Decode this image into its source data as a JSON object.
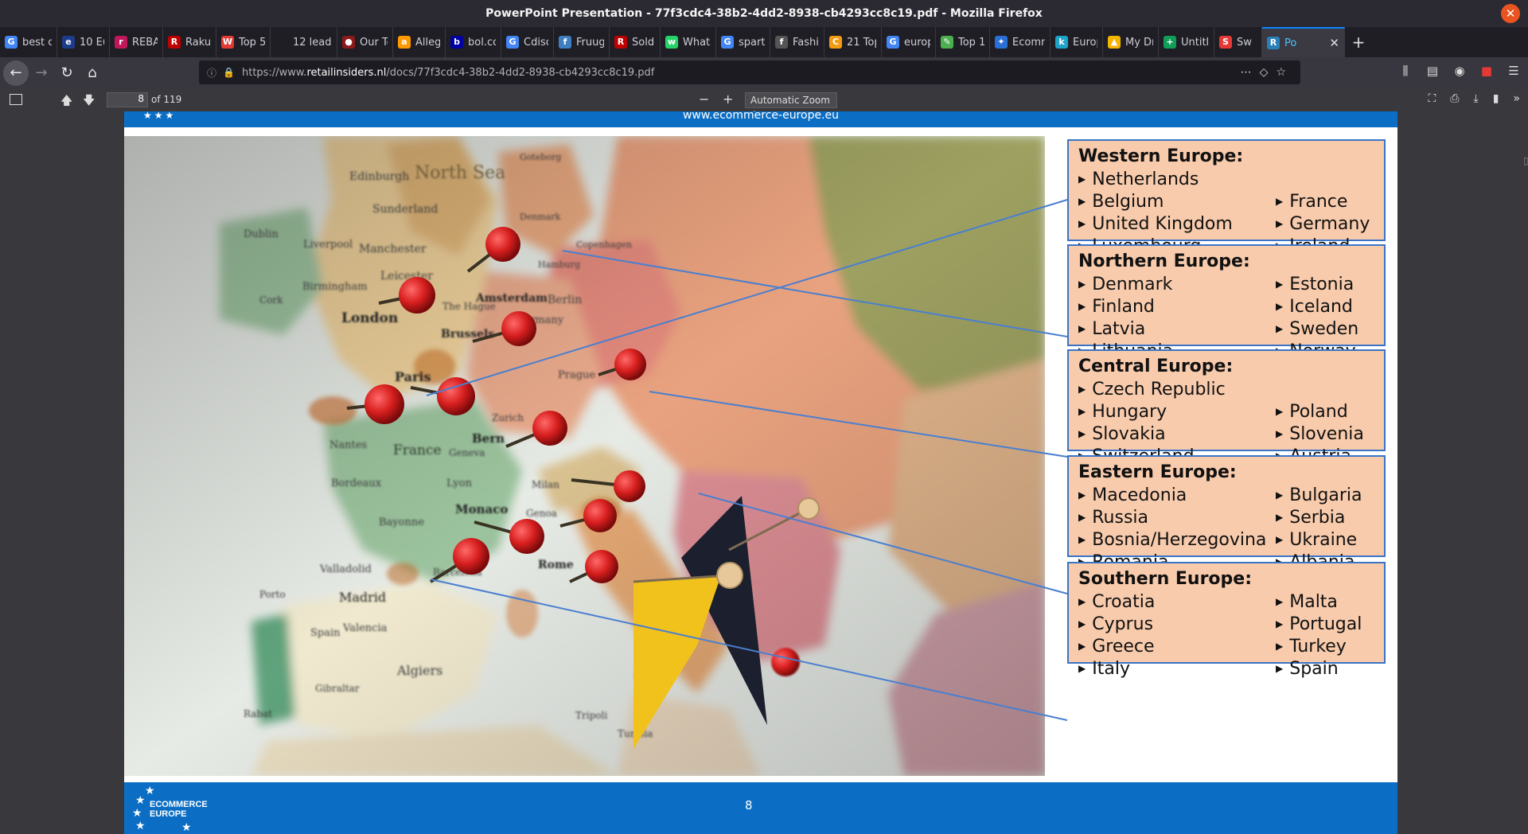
{
  "window": {
    "title": "PowerPoint Presentation - 77f3cdc4-38b2-4dd2-8938-cb4293cc8c19.pdf - Mozilla Firefox"
  },
  "tabs": [
    {
      "label": "best c",
      "icon": "google-icon",
      "color": "#4285f4",
      "glyph": "G"
    },
    {
      "label": "10 Eur",
      "icon": "e-icon",
      "color": "#1e3c8c",
      "glyph": "e"
    },
    {
      "label": "REBAI",
      "icon": "rebate-icon",
      "color": "#c2185b",
      "glyph": "r"
    },
    {
      "label": "Rakut",
      "icon": "rakuten-icon",
      "color": "#bf0000",
      "glyph": "R"
    },
    {
      "label": "Top 5",
      "icon": "w-icon",
      "color": "#e53935",
      "glyph": "W"
    },
    {
      "label": "12 leading",
      "icon": "blank-icon",
      "color": "#1f1e25",
      "glyph": ""
    },
    {
      "label": "Our Te",
      "icon": "circle-icon",
      "color": "#8b1a1a",
      "glyph": "●"
    },
    {
      "label": "Allegr",
      "icon": "amazon-icon",
      "color": "#ff9900",
      "glyph": "a"
    },
    {
      "label": "bol.co",
      "icon": "bol-icon",
      "color": "#0000a4",
      "glyph": "b"
    },
    {
      "label": "Cdisco",
      "icon": "google-icon",
      "color": "#4285f4",
      "glyph": "G"
    },
    {
      "label": "Fruug",
      "icon": "fruugo-icon",
      "color": "#3f7fbf",
      "glyph": "f"
    },
    {
      "label": "Soldes",
      "icon": "r-icon",
      "color": "#bf0000",
      "glyph": "R"
    },
    {
      "label": "Whats",
      "icon": "whatsapp-icon",
      "color": "#25d366",
      "glyph": "w"
    },
    {
      "label": "sparte",
      "icon": "google-icon",
      "color": "#4285f4",
      "glyph": "G"
    },
    {
      "label": "Fashic",
      "icon": "fashion-icon",
      "color": "#555555",
      "glyph": "f"
    },
    {
      "label": "21 Top",
      "icon": "c-icon",
      "color": "#f39c12",
      "glyph": "C"
    },
    {
      "label": "europ",
      "icon": "google-icon",
      "color": "#4285f4",
      "glyph": "G"
    },
    {
      "label": "Top 12",
      "icon": "leaf-icon",
      "color": "#4caf50",
      "glyph": "✎"
    },
    {
      "label": "Ecomm",
      "icon": "ecommerce-icon",
      "color": "#2a6fd6",
      "glyph": "✦"
    },
    {
      "label": "Europ",
      "icon": "k-icon",
      "color": "#1fa3c9",
      "glyph": "k"
    },
    {
      "label": "My Dr",
      "icon": "drive-icon",
      "color": "#f4b400",
      "glyph": "▲"
    },
    {
      "label": "Untitl",
      "icon": "sheets-icon",
      "color": "#0f9d58",
      "glyph": "+"
    },
    {
      "label": "Sw",
      "icon": "sw-icon",
      "color": "#e53935",
      "glyph": "S"
    },
    {
      "label": "Po",
      "icon": "retail-icon",
      "color": "#2b7fb8",
      "glyph": "R"
    }
  ],
  "nav": {
    "url_prefix": "https://www.",
    "url_host": "retailinsiders.nl",
    "url_path": "/docs/77f3cdc4-38b2-4dd2-8938-cb4293cc8c19.pdf"
  },
  "pdf": {
    "page_number": "8",
    "page_count": "of 119",
    "zoom": "Automatic Zoom"
  },
  "slide": {
    "top_url": "www.ecommerce-europe.eu",
    "page_num": "8",
    "logo_line1": "ECOMMERCE",
    "logo_line2": "EUROPE"
  },
  "map_labels": {
    "north_sea": "North Sea",
    "edinburgh": "Edinburgh",
    "sunderland": "Sunderland",
    "dublin": "Dublin",
    "liverpool": "Liverpool",
    "manchester": "Manchester",
    "leicester": "Leicester",
    "birmingham": "Birmingham",
    "london": "London",
    "cork": "Cork",
    "amsterdam": "Amsterdam",
    "the_hague": "The Hague",
    "brussels": "Brussels",
    "berlin": "Berlin",
    "germany": "Germany",
    "hamburg": "Hamburg",
    "copenhagen": "Copenhagen",
    "denmark": "Denmark",
    "gothenburg": "Goteborg",
    "paris": "Paris",
    "nantes": "Nantes",
    "france": "France",
    "bordeaux": "Bordeaux",
    "lyon": "Lyon",
    "geneva": "Geneva",
    "bern": "Bern",
    "zurich": "Zurich",
    "monaco": "Monaco",
    "bayonne": "Bayonne",
    "milan": "Milan",
    "genoa": "Genoa",
    "rome": "Rome",
    "prague": "Prague",
    "valladolid": "Valladolid",
    "madrid": "Madrid",
    "porto": "Porto",
    "spain": "Spain",
    "valencia": "Valencia",
    "barcelona": "Barcelona",
    "algiers": "Algiers",
    "gibraltar": "Gibraltar",
    "tunisia": "Tunisia",
    "tripoli": "Tripoli",
    "rabat": "Rabat"
  },
  "regions": [
    {
      "title": "Western Europe:",
      "left": [
        "Netherlands",
        "Belgium",
        "United Kingdom",
        "Luxembourg"
      ],
      "right": [
        "",
        "France",
        "Germany",
        "Ireland"
      ]
    },
    {
      "title": "Northern Europe:",
      "left": [
        "Denmark",
        "Finland",
        "Latvia",
        "Lithuania"
      ],
      "right": [
        "Estonia",
        "Iceland",
        "Sweden",
        "Norway"
      ]
    },
    {
      "title": "Central Europe:",
      "left": [
        "Czech Republic",
        "Hungary",
        "Slovakia",
        "Switzerland"
      ],
      "right": [
        "",
        "Poland",
        "Slovenia",
        "Austria"
      ]
    },
    {
      "title": "Eastern Europe:",
      "left": [
        "Macedonia",
        "Russia",
        "Bosnia/Herzegovina",
        "Romania"
      ],
      "right": [
        "Bulgaria",
        "Serbia",
        "Ukraine",
        "Albania"
      ]
    },
    {
      "title": "Southern Europe:",
      "left": [
        "Croatia",
        "Cyprus",
        "Greece",
        "Italy"
      ],
      "right": [
        "Malta",
        "Portugal",
        "Turkey",
        "Spain"
      ]
    }
  ],
  "colors": {
    "brand_blue": "#0b6ec4",
    "box_fill": "#f8cbac",
    "box_border": "#3a74c5",
    "pin_red": "#d81f1f"
  }
}
